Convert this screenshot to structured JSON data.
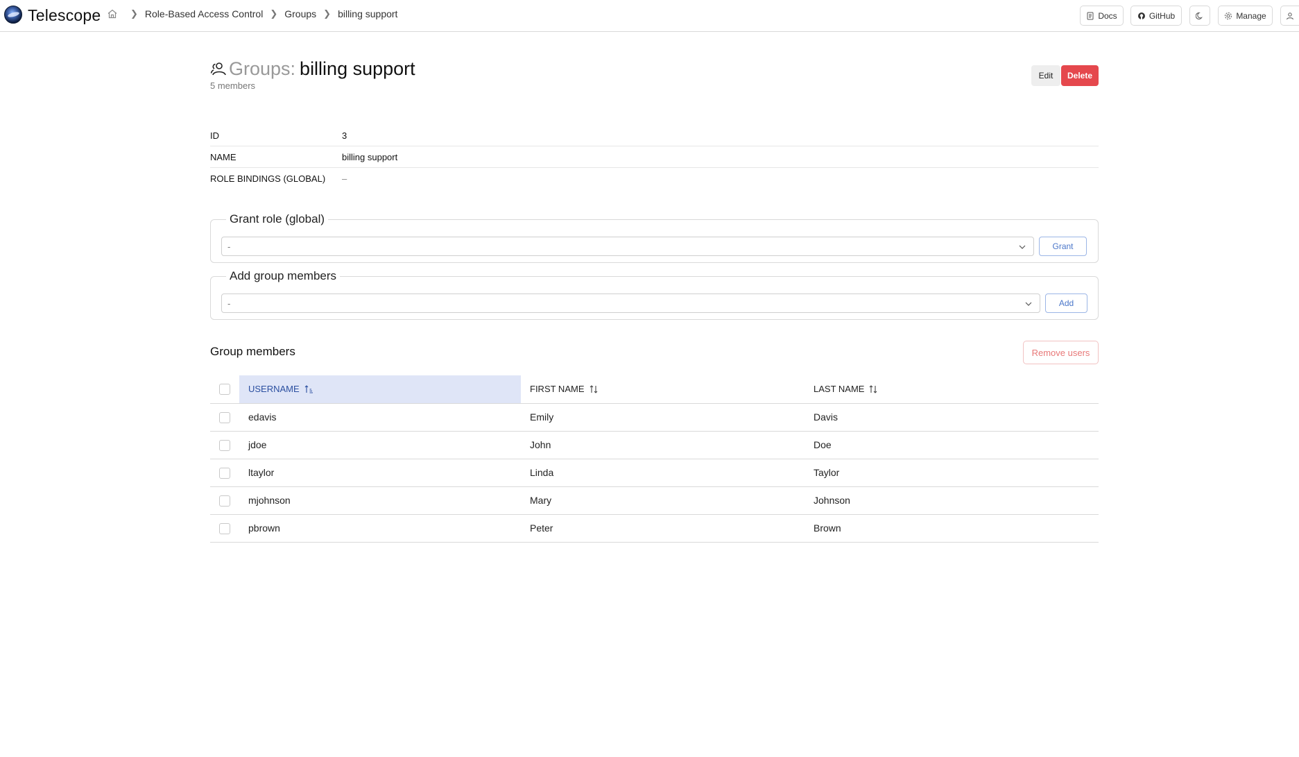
{
  "header": {
    "brand": "Telescope",
    "breadcrumbs": [
      "Role-Based Access Control",
      "Groups",
      "billing support"
    ],
    "buttons": {
      "docs": "Docs",
      "github": "GitHub",
      "manage": "Manage"
    }
  },
  "page": {
    "title_prefix": "Groups:",
    "title_name": "billing support",
    "members_count": "5 members",
    "edit_label": "Edit",
    "delete_label": "Delete"
  },
  "properties": [
    {
      "key": "ID",
      "value": "3"
    },
    {
      "key": "NAME",
      "value": "billing support"
    },
    {
      "key": "ROLE BINDINGS (GLOBAL)",
      "value": "–"
    }
  ],
  "grant_role": {
    "legend": "Grant role (global)",
    "select_value": "-",
    "button": "Grant"
  },
  "add_members": {
    "legend": "Add group members",
    "select_value": "-",
    "button": "Add"
  },
  "members_section": {
    "title": "Group members",
    "remove_button": "Remove users",
    "columns": [
      "USERNAME",
      "FIRST NAME",
      "LAST NAME"
    ],
    "sorted_column": "USERNAME",
    "rows": [
      {
        "username": "edavis",
        "first": "Emily",
        "last": "Davis"
      },
      {
        "username": "jdoe",
        "first": "John",
        "last": "Doe"
      },
      {
        "username": "ltaylor",
        "first": "Linda",
        "last": "Taylor"
      },
      {
        "username": "mjohnson",
        "first": "Mary",
        "last": "Johnson"
      },
      {
        "username": "pbrown",
        "first": "Peter",
        "last": "Brown"
      }
    ]
  },
  "colors": {
    "delete": "#e5484d",
    "sorted_header_bg": "#dfe5f7",
    "accent_blue": "#4a76c9",
    "remove_text": "#e87878"
  }
}
